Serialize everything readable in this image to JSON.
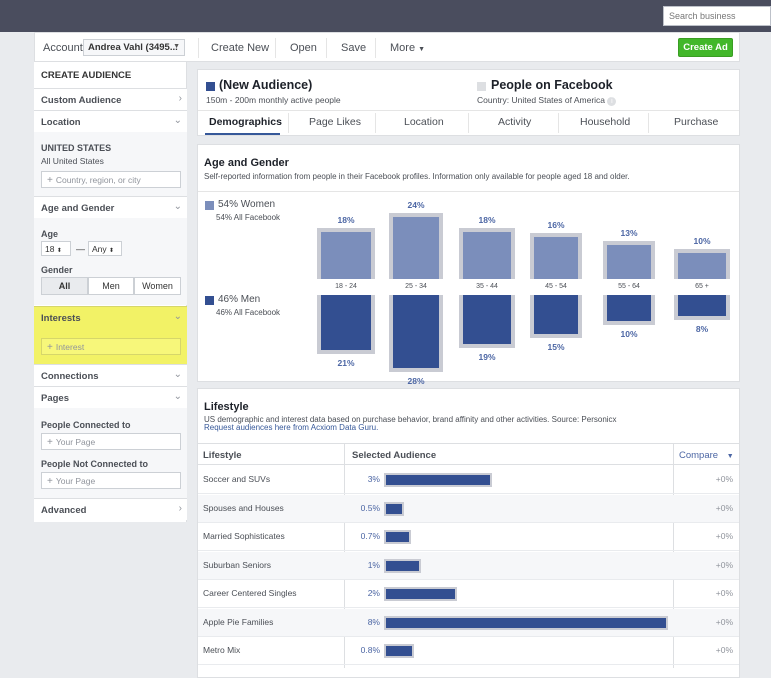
{
  "header": {
    "search_placeholder": "Search business"
  },
  "toolbar": {
    "account_label": "Account:",
    "account_value": "Andrea Vahl (3495...",
    "create_new": "Create New",
    "open": "Open",
    "save": "Save",
    "more": "More",
    "create_ad": "Create Ad"
  },
  "sidebar": {
    "heading": "CREATE AUDIENCE",
    "custom_audience": "Custom Audience",
    "location": "Location",
    "country": "UNITED STATES",
    "country_sub": "All United States",
    "location_placeholder": "Country, region, or city",
    "age_gender": "Age and Gender",
    "age_label": "Age",
    "age_min": "18",
    "age_dash": "—",
    "age_max": "Any",
    "gender_label": "Gender",
    "gender_options": [
      "All",
      "Men",
      "Women"
    ],
    "interests": "Interests",
    "interest_placeholder": "Interest",
    "connections": "Connections",
    "pages": "Pages",
    "people_connected": "People Connected to",
    "your_page_1": "Your Page",
    "people_not_connected": "People Not Connected to",
    "your_page_2": "Your Page",
    "advanced": "Advanced"
  },
  "audience": {
    "title": "(New Audience)",
    "subtitle": "150m - 200m monthly active people",
    "compare_title": "People on Facebook",
    "compare_sub": "Country: United States of America",
    "info": "i",
    "color_audience": "#334f91",
    "color_compare": "#dddfe2"
  },
  "tabs": [
    "Demographics",
    "Page Likes",
    "Location",
    "Activity",
    "Household",
    "Purchase"
  ],
  "age_gender": {
    "title": "Age and Gender",
    "subtitle": "Self-reported information from people in their Facebook profiles. Information only available for people aged 18 and older.",
    "women_label": "54% Women",
    "women_sub": "54% All Facebook",
    "men_label": "46% Men",
    "men_sub": "46% All Facebook",
    "age_ranges": [
      "18 - 24",
      "25 - 34",
      "35 - 44",
      "45 - 54",
      "55 - 64",
      "65 +"
    ],
    "women_pct": [
      "18%",
      "24%",
      "18%",
      "16%",
      "13%",
      "10%"
    ],
    "men_pct": [
      "21%",
      "28%",
      "19%",
      "15%",
      "10%",
      "8%"
    ]
  },
  "chart_data": {
    "type": "bar",
    "categories": [
      "18 - 24",
      "25 - 34",
      "35 - 44",
      "45 - 54",
      "55 - 64",
      "65 +"
    ],
    "series": [
      {
        "name": "54% Women",
        "values": [
          18,
          24,
          18,
          16,
          13,
          10
        ]
      },
      {
        "name": "46% Men",
        "values": [
          21,
          28,
          19,
          15,
          10,
          8
        ]
      }
    ]
  },
  "lifestyle": {
    "title": "Lifestyle",
    "subtitle": "US demographic and interest data based on purchase behavior, brand affinity and other activities. Source: Personicx",
    "link": "Request audiences here from Acxiom Data Guru.",
    "col_lifestyle": "Lifestyle",
    "col_selected": "Selected Audience",
    "col_compare": "Compare",
    "rows": [
      {
        "name": "Soccer and SUVs",
        "pct": "3%",
        "value": 3,
        "compare": "+0%"
      },
      {
        "name": "Spouses and Houses",
        "pct": "0.5%",
        "value": 0.5,
        "compare": "+0%"
      },
      {
        "name": "Married Sophisticates",
        "pct": "0.7%",
        "value": 0.7,
        "compare": "+0%"
      },
      {
        "name": "Suburban Seniors",
        "pct": "1%",
        "value": 1,
        "compare": "+0%"
      },
      {
        "name": "Career Centered Singles",
        "pct": "2%",
        "value": 2,
        "compare": "+0%"
      },
      {
        "name": "Apple Pie Families",
        "pct": "8%",
        "value": 8,
        "compare": "+0%"
      },
      {
        "name": "Metro Mix",
        "pct": "0.8%",
        "value": 0.8,
        "compare": "+0%"
      }
    ]
  }
}
